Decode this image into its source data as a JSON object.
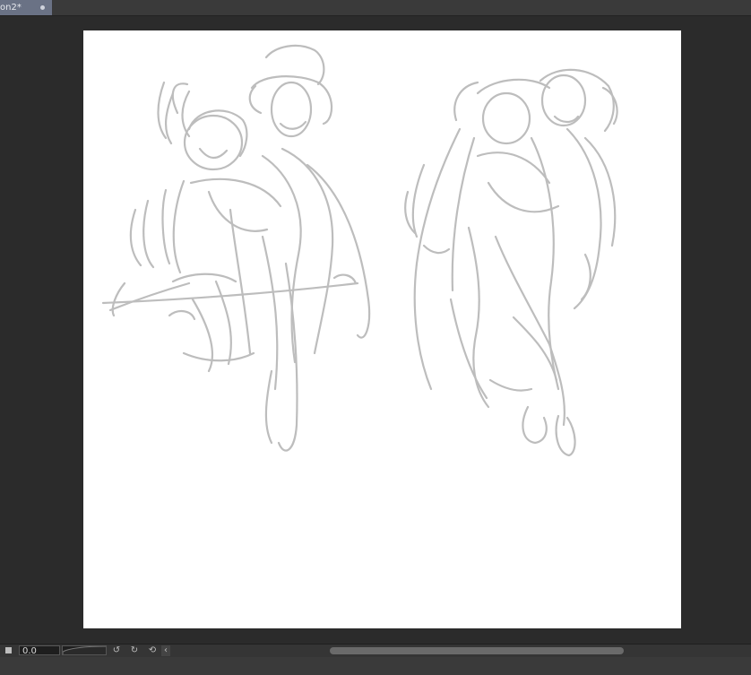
{
  "document_tab": {
    "label": "on2*",
    "close_icon": "dot-close-icon",
    "active_color": "#6a7285"
  },
  "colors": {
    "workspace_bg": "#2b2b2b",
    "canvas_bg": "#ffffff",
    "sketch_stroke": "#bdbdbd"
  },
  "canvas": {
    "content": "rough pencil sketch of two figures"
  },
  "statusbar": {
    "stop_icon": "stop-icon",
    "zoom_value": "0.0",
    "rotate_left_icon": "rotate-left-icon",
    "rotate_right_icon": "rotate-right-icon",
    "reset_rotation_icon": "reset-rotation-icon",
    "flip_icon": "chevron-left-icon"
  }
}
